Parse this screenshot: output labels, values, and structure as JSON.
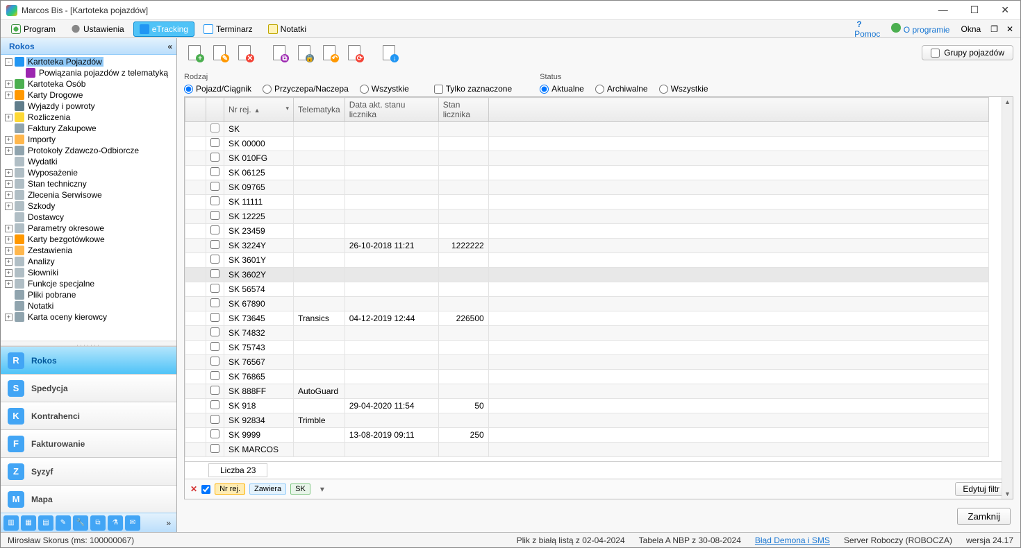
{
  "window": {
    "title": "Marcos Bis - [Kartoteka pojazdów]"
  },
  "menubar": {
    "program": "Program",
    "ustawienia": "Ustawienia",
    "etracking": "eTracking",
    "terminarz": "Terminarz",
    "notatki": "Notatki",
    "pomoc": "Pomoc",
    "oprogramie": "O programie",
    "okna": "Okna"
  },
  "sidebar": {
    "header": "Rokos",
    "tree": [
      {
        "exp": "-",
        "label": "Kartoteka Pojazdów",
        "icon": "car",
        "selected": true
      },
      {
        "exp": "",
        "label": "Powiązania pojazdów z telematyką",
        "icon": "link",
        "indent": 1
      },
      {
        "exp": "",
        "label": "Kartoteka Osób",
        "icon": "people",
        "indent": 0,
        "expbox": "+"
      },
      {
        "exp": "",
        "label": "Karty Drogowe",
        "icon": "card",
        "indent": 0,
        "expbox": "+"
      },
      {
        "exp": "",
        "label": "Wyjazdy i powroty",
        "icon": "road",
        "indent": 0
      },
      {
        "exp": "",
        "label": "Rozliczenia",
        "icon": "money",
        "indent": 0,
        "expbox": "+"
      },
      {
        "exp": "",
        "label": "Faktury Zakupowe",
        "icon": "doc",
        "indent": 0
      },
      {
        "exp": "",
        "label": "Importy",
        "icon": "folder",
        "indent": 0,
        "expbox": "+"
      },
      {
        "exp": "",
        "label": "Protokoły Zdawczo-Odbiorcze",
        "icon": "doc",
        "indent": 0,
        "expbox": "+"
      },
      {
        "exp": "",
        "label": "Wydatki",
        "icon": "gen",
        "indent": 0
      },
      {
        "exp": "",
        "label": "Wyposażenie",
        "icon": "gen",
        "indent": 0,
        "expbox": "+"
      },
      {
        "exp": "",
        "label": "Stan techniczny",
        "icon": "gen",
        "indent": 0,
        "expbox": "+"
      },
      {
        "exp": "",
        "label": "Zlecenia Serwisowe",
        "icon": "gen",
        "indent": 0,
        "expbox": "+"
      },
      {
        "exp": "",
        "label": "Szkody",
        "icon": "gen",
        "indent": 0,
        "expbox": "+"
      },
      {
        "exp": "",
        "label": "Dostawcy",
        "icon": "gen",
        "indent": 0
      },
      {
        "exp": "",
        "label": "Parametry okresowe",
        "icon": "gen",
        "indent": 0,
        "expbox": "+"
      },
      {
        "exp": "",
        "label": "Karty bezgotówkowe",
        "icon": "card",
        "indent": 0,
        "expbox": "+"
      },
      {
        "exp": "",
        "label": "Zestawienia",
        "icon": "folder",
        "indent": 0,
        "expbox": "+"
      },
      {
        "exp": "",
        "label": "Analizy",
        "icon": "gen",
        "indent": 0,
        "expbox": "+"
      },
      {
        "exp": "",
        "label": "Słowniki",
        "icon": "gen",
        "indent": 0,
        "expbox": "+"
      },
      {
        "exp": "",
        "label": "Funkcje specjalne",
        "icon": "gen",
        "indent": 0,
        "expbox": "+"
      },
      {
        "exp": "",
        "label": "Pliki pobrane",
        "icon": "doc",
        "indent": 0
      },
      {
        "exp": "",
        "label": "Notatki",
        "icon": "doc",
        "indent": 0
      },
      {
        "exp": "",
        "label": "Karta oceny kierowcy",
        "icon": "doc",
        "indent": 0,
        "expbox": "+"
      }
    ],
    "sections": [
      {
        "label": "Rokos",
        "icon": "R",
        "active": true
      },
      {
        "label": "Spedycja",
        "icon": "S"
      },
      {
        "label": "Kontrahenci",
        "icon": "K"
      },
      {
        "label": "Fakturowanie",
        "icon": "F"
      },
      {
        "label": "Syzyf",
        "icon": "Z"
      },
      {
        "label": "Mapa",
        "icon": "M"
      }
    ]
  },
  "filters": {
    "rodzaj_label": "Rodzaj",
    "status_label": "Status",
    "rodzaj": {
      "pojazd": "Pojazd/Ciągnik",
      "przyczepa": "Przyczepa/Naczepa",
      "wszystkie": "Wszystkie",
      "tylko": "Tylko zaznaczone"
    },
    "status": {
      "aktualne": "Aktualne",
      "archiwalne": "Archiwalne",
      "wszystkie": "Wszystkie"
    },
    "grupy_btn": "Grupy pojazdów"
  },
  "grid": {
    "columns": {
      "nr_rej": "Nr rej.",
      "telematyka": "Telematyka",
      "data_akt": "Data akt. stanu licznika",
      "stan": "Stan licznika"
    },
    "rows": [
      {
        "nr": "SK",
        "tel": "",
        "data": "",
        "stan": "",
        "hdrchk": true
      },
      {
        "nr": "SK 00000",
        "tel": "",
        "data": "",
        "stan": ""
      },
      {
        "nr": "SK 010FG",
        "tel": "",
        "data": "",
        "stan": ""
      },
      {
        "nr": "SK 06125",
        "tel": "",
        "data": "",
        "stan": ""
      },
      {
        "nr": "SK 09765",
        "tel": "",
        "data": "",
        "stan": ""
      },
      {
        "nr": "SK 11111",
        "tel": "",
        "data": "",
        "stan": ""
      },
      {
        "nr": "SK 12225",
        "tel": "",
        "data": "",
        "stan": ""
      },
      {
        "nr": "SK 23459",
        "tel": "",
        "data": "",
        "stan": ""
      },
      {
        "nr": "SK 3224Y",
        "tel": "",
        "data": "26-10-2018 11:21",
        "stan": "1222222"
      },
      {
        "nr": "SK 3601Y",
        "tel": "",
        "data": "",
        "stan": ""
      },
      {
        "nr": "SK 3602Y",
        "tel": "",
        "data": "",
        "stan": "",
        "selected": true
      },
      {
        "nr": "SK 56574",
        "tel": "",
        "data": "",
        "stan": ""
      },
      {
        "nr": "SK 67890",
        "tel": "",
        "data": "",
        "stan": ""
      },
      {
        "nr": "SK 73645",
        "tel": "Transics",
        "data": "04-12-2019 12:44",
        "stan": "226500"
      },
      {
        "nr": "SK 74832",
        "tel": "",
        "data": "",
        "stan": ""
      },
      {
        "nr": "SK 75743",
        "tel": "",
        "data": "",
        "stan": ""
      },
      {
        "nr": "SK 76567",
        "tel": "",
        "data": "",
        "stan": ""
      },
      {
        "nr": "SK 76865",
        "tel": "",
        "data": "",
        "stan": ""
      },
      {
        "nr": "SK 888FF",
        "tel": "AutoGuard",
        "data": "",
        "stan": ""
      },
      {
        "nr": "SK 918",
        "tel": "",
        "data": "29-04-2020 11:54",
        "stan": "50"
      },
      {
        "nr": "SK 92834",
        "tel": "Trimble",
        "data": "",
        "stan": ""
      },
      {
        "nr": "SK 9999",
        "tel": "",
        "data": "13-08-2019 09:11",
        "stan": "250"
      },
      {
        "nr": "SK MARCOS",
        "tel": "",
        "data": "",
        "stan": ""
      }
    ],
    "count_label": "Liczba 23"
  },
  "filterbar": {
    "col": "Nr rej.",
    "op": "Zawiera",
    "val": "SK",
    "edit": "Edytuj filtr"
  },
  "buttons": {
    "zamknij": "Zamknij"
  },
  "status": {
    "user": "Mirosław Skorus (ms: 100000067)",
    "whitelist": "Plik z białą listą z 02-04-2024",
    "nbp": "Tabela A NBP z 30-08-2024",
    "error": "Błąd Demona i SMS",
    "server": "Server Roboczy (ROBOCZA)",
    "version": "wersja 24.17"
  }
}
